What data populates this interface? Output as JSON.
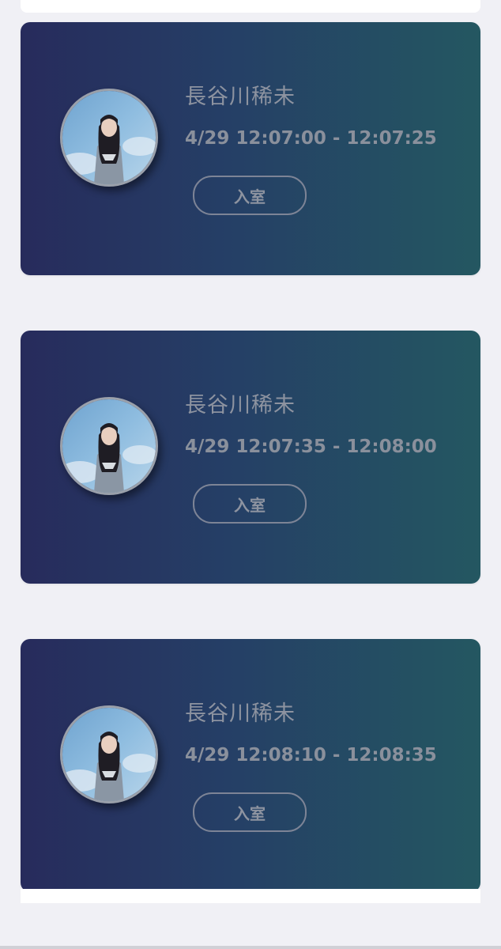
{
  "cards": [
    {
      "name": "長谷川稀未",
      "time": "4/29 12:07:00 - 12:07:25",
      "button_label": "入室"
    },
    {
      "name": "長谷川稀未",
      "time": "4/29 12:07:35 - 12:08:00",
      "button_label": "入室"
    },
    {
      "name": "長谷川稀未",
      "time": "4/29 12:08:10 - 12:08:35",
      "button_label": "入室"
    }
  ],
  "colors": {
    "page_background": "#f0f0f5",
    "card_gradient_start": "#272b5c",
    "card_gradient_end": "#245761",
    "text_muted": "#8d93a0"
  }
}
